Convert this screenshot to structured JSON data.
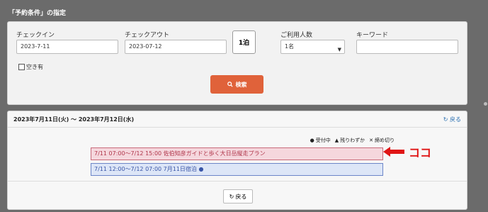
{
  "section_title": "「予約条件」の指定",
  "search": {
    "checkin_label": "チェックイン",
    "checkin_value": "2023-7-11",
    "checkout_label": "チェックアウト",
    "checkout_value": "2023-07-12",
    "nights": "1泊",
    "guests_label": "ご利用人数",
    "guests_value": "1名",
    "keyword_label": "キーワード",
    "keyword_value": "",
    "vacancy_label": "空き有",
    "search_button": "検索"
  },
  "results": {
    "date_range": "2023年7月11日(火) ～ 2023年7月12日(水)",
    "back_top": "戻る",
    "legend": {
      "available": "受付中",
      "few_left": "残りわずか",
      "closed": "締め切り"
    },
    "plans": [
      {
        "text": "7/11 07:00～7/12 15:00 佐伯知彦ガイドと歩く大日岳縦走プラン"
      },
      {
        "text": "7/11 12:00～7/12 07:00 7月11日宿泊 ●"
      }
    ],
    "back_bottom": "戻る"
  },
  "annotation": "ココ",
  "colors": {
    "search_button": "#e0623a",
    "annotation": "#e01515"
  }
}
